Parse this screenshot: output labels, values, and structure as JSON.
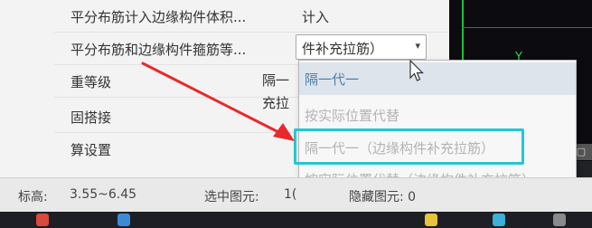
{
  "settings": {
    "rows": [
      {
        "label": "平分布筋计入边缘构件体积...",
        "value": "计入"
      },
      {
        "label": "平分布筋和边缘构件箍筋等...",
        "value": ""
      },
      {
        "label": "重等级",
        "value": ""
      },
      {
        "label": "固搭接",
        "value": ""
      },
      {
        "label": "算设置",
        "value": ""
      }
    ],
    "combobox_value": "件补充拉筋）",
    "combobox_arrow": "▾",
    "obscured_lines": [
      "隔一",
      "充拉"
    ]
  },
  "dropdown": {
    "options": [
      "隔一代一",
      "按实际位置代替",
      "隔一代一（边缘构件补充拉筋）",
      "按实际位置代替（边缘构件补充拉筋）"
    ],
    "highlight_color": "#22c8d4"
  },
  "status_bar": {
    "elevation_label": "标高:",
    "elevation_value": "3.55~6.45",
    "selected_label": "选中图元:",
    "selected_value": "1(",
    "hidden_label": "隐藏图元: 0"
  },
  "canvas": {
    "axis_label": "Y",
    "badge_text": "▢"
  },
  "colors": {
    "arrow": "#e8292b",
    "highlight": "#22c8d4",
    "selected_option_text": "#4d7ea8",
    "cad_green": "#1fbf3a"
  },
  "icons": {
    "cursor": "mouse-pointer",
    "arrow": "annotation-arrow"
  }
}
